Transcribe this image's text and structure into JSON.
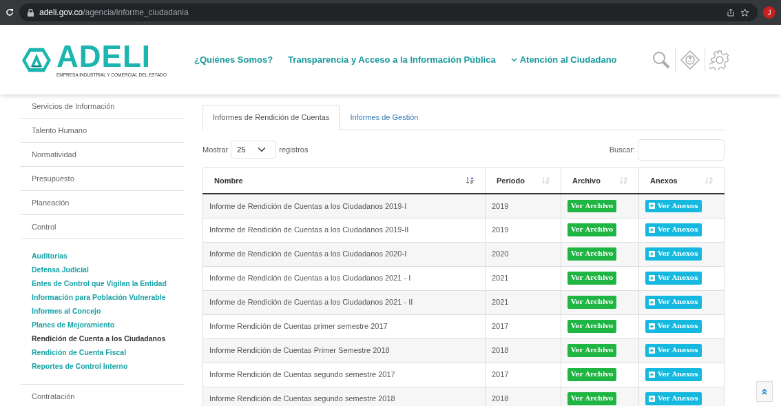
{
  "browser": {
    "url_host": "adeli.gov.co",
    "url_path": "/agencia/informe_ciudadania",
    "profile_initial": "J"
  },
  "header": {
    "logo_text": "ADELI",
    "logo_subtitle": "EMPRESA INDUSTRIAL Y COMERCIAL DEL ESTADO",
    "nav": [
      {
        "label": "¿Quiénes Somos?",
        "dropdown": false
      },
      {
        "label": "Transparencia y Acceso a la Información Pública",
        "dropdown": false
      },
      {
        "label": "Atención al Ciudadano",
        "dropdown": true
      }
    ]
  },
  "sidebar": {
    "items": [
      {
        "kind": "menu",
        "label": "Servicios de Información"
      },
      {
        "kind": "menu",
        "label": "Talento Humano"
      },
      {
        "kind": "menu",
        "label": "Normatividad"
      },
      {
        "kind": "menu",
        "label": "Presupuesto"
      },
      {
        "kind": "menu",
        "label": "Planeación"
      },
      {
        "kind": "menu",
        "label": "Control",
        "children": [
          {
            "label": "Auditorias",
            "selected": false
          },
          {
            "label": "Defensa Judicial",
            "selected": false
          },
          {
            "label": "Entes de Control que Vigilan la Entidad",
            "selected": false
          },
          {
            "label": "Información para Población Vulnerable",
            "selected": false
          },
          {
            "label": "Informes al Concejo",
            "selected": false
          },
          {
            "label": "Planes de Mejoramiento",
            "selected": false
          },
          {
            "label": "Rendición de Cuenta a los Ciudadanos",
            "selected": true
          },
          {
            "label": "Rendición de Cuenta Fiscal",
            "selected": false
          },
          {
            "label": "Reportes de Control Interno",
            "selected": false
          }
        ]
      },
      {
        "kind": "menu",
        "label": "Contratación"
      }
    ]
  },
  "tabs": [
    {
      "label": "Informes de Rendición de Cuentas",
      "selected": true
    },
    {
      "label": "Informes de Gestión",
      "selected": false
    }
  ],
  "length_control": {
    "before": "Mostrar",
    "value": "25",
    "after": "registros"
  },
  "search": {
    "label": "Buscar:"
  },
  "table": {
    "columns": [
      {
        "label": "Nombre",
        "sorted": true
      },
      {
        "label": "Periodo",
        "sorted": false
      },
      {
        "label": "Archivo",
        "sorted": false
      },
      {
        "label": "Anexos",
        "sorted": false
      }
    ],
    "rows": [
      {
        "nombre": "Informe de Rendición de Cuentas a los Ciudadanos 2019-I",
        "periodo": "2019",
        "archivo": "Ver Archivo",
        "anexos": "Ver Anexos"
      },
      {
        "nombre": "Informe de Rendición de Cuentas a los Ciudadanos 2019-II",
        "periodo": "2019",
        "archivo": "Ver Archivo",
        "anexos": "Ver Anexos"
      },
      {
        "nombre": "Informe de Rendición de Cuentas a los Ciudadanos 2020-I",
        "periodo": "2020",
        "archivo": "Ver Archivo",
        "anexos": "Ver Anexos"
      },
      {
        "nombre": "Informe de Rendición de Cuentas a los Ciudadanos 2021 - I",
        "periodo": "2021",
        "archivo": "Ver Archivo",
        "anexos": "Ver Anexos"
      },
      {
        "nombre": "Informe de Rendición de Cuentas a los Ciudadanos 2021 - II",
        "periodo": "2021",
        "archivo": "Ver Archivo",
        "anexos": "Ver Anexos"
      },
      {
        "nombre": "Informe Rendición de Cuentas primer semestre 2017",
        "periodo": "2017",
        "archivo": "Ver Archivo",
        "anexos": "Ver Anexos"
      },
      {
        "nombre": "Informe Rendición de Cuentas Primer Semestre 2018",
        "periodo": "2018",
        "archivo": "Ver Archivo",
        "anexos": "Ver Anexos"
      },
      {
        "nombre": "Informe Rendición de Cuentas segundo semestre 2017",
        "periodo": "2017",
        "archivo": "Ver Archivo",
        "anexos": "Ver Anexos"
      },
      {
        "nombre": "Informe Rendición de Cuentas segundo semestre 2018",
        "periodo": "2018",
        "archivo": "Ver Archivo",
        "anexos": "Ver Anexos"
      }
    ]
  }
}
